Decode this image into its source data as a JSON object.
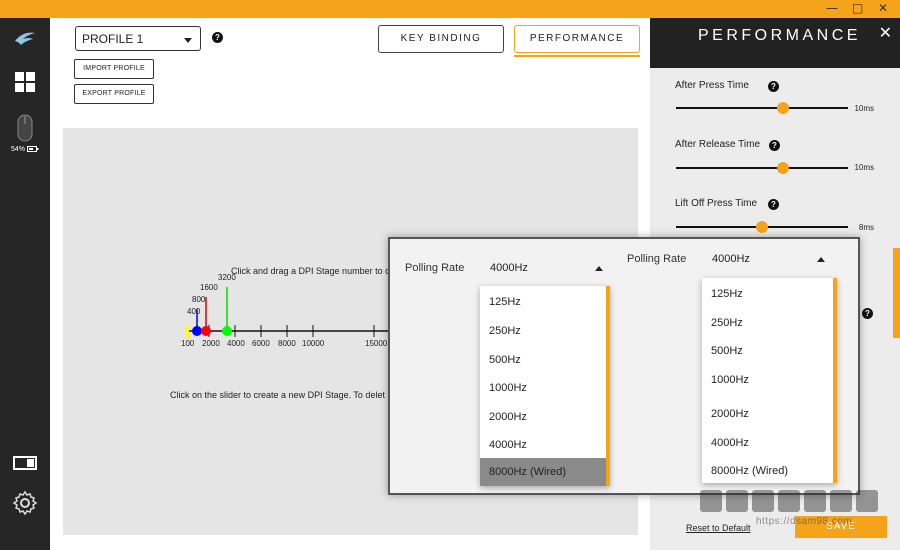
{
  "window": {
    "controls": [
      "—",
      "□",
      "✕"
    ]
  },
  "sidebar": {
    "battery_text": "54%",
    "icons": [
      "logo-icon",
      "grid-icon",
      "mouse-icon",
      "battery-icon",
      "device-toggle-icon",
      "settings-icon"
    ]
  },
  "header": {
    "profile_value": "PROFILE 1",
    "help": "?",
    "import_profile": "IMPORT PROFILE",
    "export_profile": "EXPORT PROFILE",
    "tab_key_binding": "KEY BINDING",
    "tab_performance": "PERFORMANCE"
  },
  "dpi": {
    "drag_hint": "Click and drag a DPI Stage number to c",
    "create_hint": "Click on the slider to create a new DPI Stage. To delet",
    "stage_labels": [
      "400",
      "800",
      "1600",
      "3200"
    ],
    "tick_labels": [
      "100",
      "2000",
      "4000",
      "6000",
      "8000",
      "10000",
      "15000"
    ],
    "stage_colors": [
      "#ffff00",
      "#0000ff",
      "#ff0000",
      "#00ff00"
    ]
  },
  "performance": {
    "title": "PERFORMANCE",
    "close": "✕",
    "after_press_label": "After Press Time",
    "after_press_value": "10ms",
    "after_press_level": 0.62,
    "after_release_label": "After Release Time",
    "after_release_value": "10ms",
    "after_release_level": 0.62,
    "lift_off_label": "Lift Off Press Time",
    "lift_off_value": "8ms",
    "lift_off_level": 0.5,
    "reset_label": "Reset to Default",
    "save_label": "SAVE",
    "accent_color": "#f5a31a"
  },
  "polling": {
    "left": {
      "label": "Polling Rate",
      "value": "4000Hz",
      "options": [
        "125Hz",
        "250Hz",
        "500Hz",
        "1000Hz",
        "2000Hz",
        "4000Hz",
        "8000Hz (Wired)"
      ],
      "selected": "8000Hz (Wired)"
    },
    "right": {
      "label": "Polling Rate",
      "value": "4000Hz",
      "options": [
        "125Hz",
        "250Hz",
        "500Hz",
        "1000Hz",
        "2000Hz",
        "4000Hz",
        "8000Hz (Wired)"
      ]
    }
  },
  "watermark": {
    "text": "https://dsam98.com"
  }
}
